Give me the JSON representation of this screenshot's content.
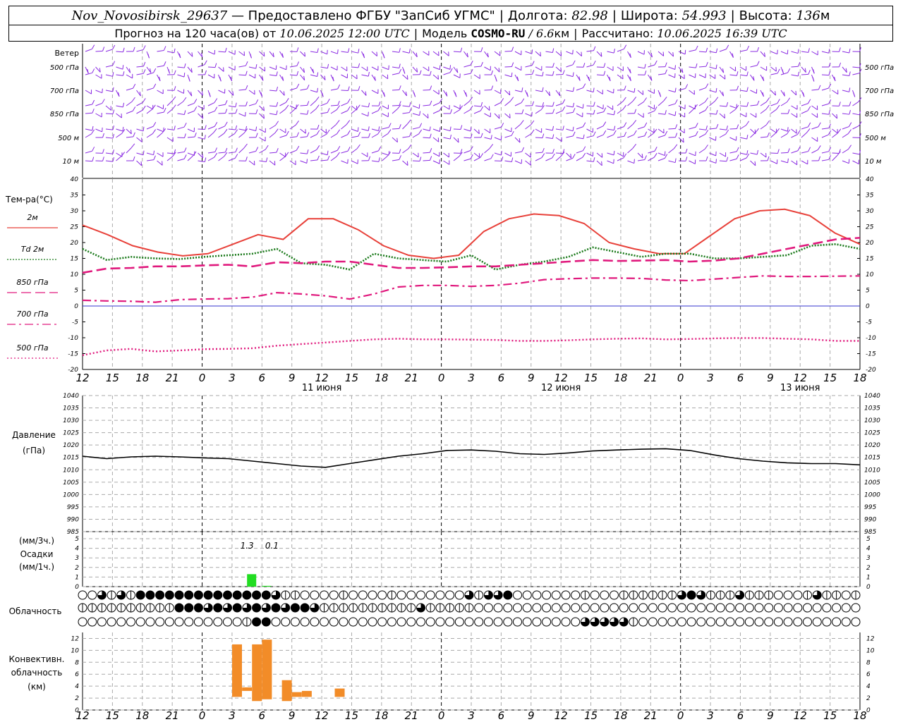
{
  "header": {
    "station": "Nov_Novosibirsk_29637",
    "provider": "— Предоставлено ФГБУ \"ЗапСиб УГМС\"",
    "lon_label": "Долгота:",
    "lon": "82.98",
    "lat_label": "Широта:",
    "lat": "54.993",
    "alt_label": "Высота:",
    "alt": "136",
    "alt_unit": "м",
    "forecast_label": "Прогноз на 120 часа(ов) от",
    "forecast_time": "10.06.2025 12:00 UTC",
    "model_label": "Модель",
    "model": "COSMO-RU",
    "resolution": "/ 6.6",
    "res_unit": "км",
    "computed_label": "Рассчитано:",
    "computed_time": "10.06.2025 16:39 UTC"
  },
  "time_axis": {
    "ticks": [
      "12",
      "15",
      "18",
      "21",
      "0",
      "3",
      "6",
      "9",
      "12",
      "15",
      "18",
      "21",
      "0",
      "3",
      "6",
      "9",
      "12",
      "15",
      "18",
      "21",
      "0",
      "3",
      "6",
      "9",
      "12",
      "15",
      "18"
    ],
    "dates": [
      {
        "label": "11 июня",
        "hour": 24
      },
      {
        "label": "12 июня",
        "hour": 48
      },
      {
        "label": "13 июня",
        "hour": 72
      }
    ],
    "midnight_hours": [
      12,
      36,
      60
    ]
  },
  "wind_panel": {
    "title": "Ветер",
    "levels": [
      "500 гПа",
      "700 гПа",
      "850 гПа",
      "500 м",
      "10 м"
    ]
  },
  "colors": {
    "t2m": "#e8413a",
    "td2m": "#1b7a1b",
    "t850": "#e0197d",
    "t700": "#e0197d",
    "t500": "#e0197d",
    "wind": "#8a2be2",
    "pressure": "#000000",
    "precip": "#22dd22",
    "convective": "#f28c28",
    "zero_line": "#3333cc"
  },
  "chart_data": [
    {
      "type": "line",
      "title": "Тем-ра(°C)",
      "ylim": [
        -20,
        40
      ],
      "y_ticks": [
        -20,
        -15,
        -10,
        -5,
        0,
        5,
        10,
        15,
        20,
        25,
        30,
        35,
        40
      ],
      "x_hours": [
        0,
        3,
        6,
        9,
        12,
        15,
        18,
        21,
        24,
        27,
        30,
        33,
        36,
        39,
        42,
        45,
        48,
        51,
        54,
        57,
        60,
        63,
        66,
        69,
        72,
        75,
        78
      ],
      "series": [
        {
          "name": "2м",
          "style": "solid",
          "values": [
            25.5,
            22.5,
            19,
            17,
            15.8,
            16.5,
            19.5,
            22.5,
            21,
            27.5,
            27.5,
            24,
            19,
            16,
            15,
            16,
            23.5,
            27.5,
            29,
            28.5,
            26,
            20,
            18,
            16.5,
            16.5,
            22,
            27.5,
            30,
            30.5,
            28.5,
            23,
            19.5
          ]
        },
        {
          "name": "Td 2м",
          "style": "dotted",
          "values": [
            18,
            14.5,
            15.5,
            15,
            14.8,
            15.5,
            16,
            16.5,
            18,
            13.5,
            13,
            11.5,
            16.5,
            15,
            14.5,
            14,
            16,
            11.5,
            13,
            14,
            15.5,
            18.5,
            17,
            15.5,
            16.5,
            16.5,
            15,
            15,
            15.5,
            16,
            19,
            19.5,
            18
          ]
        },
        {
          "name": "850 гПа",
          "style": "dashed",
          "values": [
            10.5,
            11.8,
            12,
            12.5,
            12.5,
            12.8,
            13,
            12.5,
            13.8,
            13.5,
            14,
            14,
            13,
            12,
            12,
            12.2,
            12.5,
            12.5,
            13,
            13.5,
            14,
            14.5,
            14.2,
            14.3,
            14.5,
            14,
            14.3,
            15,
            16.5,
            18,
            19.5,
            21,
            21.5
          ]
        },
        {
          "name": "700 гПа",
          "style": "dashdot",
          "values": [
            1.8,
            1.6,
            1.5,
            1.2,
            2,
            2.2,
            2.3,
            2.8,
            4.2,
            3.8,
            3.2,
            2.2,
            3.8,
            6,
            6.5,
            6.5,
            6.2,
            6.5,
            7.2,
            8.3,
            8.6,
            8.8,
            8.8,
            8.7,
            8.2,
            8,
            8.5,
            9,
            9.5,
            9.3,
            9.3,
            9.4,
            9.5
          ]
        },
        {
          "name": "500 гПа",
          "style": "dotted-fine",
          "values": [
            -15.5,
            -14,
            -13.5,
            -14.3,
            -14,
            -13.6,
            -13.5,
            -13.3,
            -12.5,
            -12,
            -11.5,
            -11,
            -10.5,
            -10.3,
            -10.5,
            -10.5,
            -10.6,
            -10.7,
            -11,
            -11,
            -10.8,
            -10.5,
            -10.3,
            -10.2,
            -10.5,
            -10.4,
            -10.2,
            -10.1,
            -10.1,
            -10.3,
            -10.5,
            -11,
            -11
          ]
        }
      ]
    },
    {
      "type": "line",
      "title": "Давление",
      "unit": "(гПа)",
      "ylim": [
        985,
        1040
      ],
      "y_ticks": [
        985,
        990,
        995,
        1000,
        1005,
        1010,
        1015,
        1020,
        1025,
        1030,
        1035,
        1040
      ],
      "x_hours": [
        0,
        3,
        6,
        9,
        12,
        15,
        18,
        21,
        24,
        27,
        30,
        33,
        36,
        39,
        42,
        45,
        48,
        51,
        54,
        57,
        60,
        63,
        66,
        69,
        72,
        75,
        78
      ],
      "series": [
        {
          "name": "Давление",
          "values": [
            1015.5,
            1014.5,
            1015.2,
            1015.5,
            1015.2,
            1014.8,
            1014.5,
            1013.5,
            1012.5,
            1011.5,
            1011,
            1012.5,
            1014,
            1015.5,
            1016.5,
            1017.8,
            1018,
            1017.5,
            1016.5,
            1016.2,
            1016.8,
            1017.6,
            1018,
            1018.3,
            1018.5,
            1017.8,
            1016,
            1014.5,
            1013.5,
            1012.8,
            1012.5,
            1012.5,
            1012
          ]
        }
      ]
    },
    {
      "type": "bar",
      "title": "Осадки",
      "units": [
        "(мм/3ч.)",
        "(мм/1ч.)"
      ],
      "ylim": [
        0,
        5
      ],
      "y_ticks": [
        0,
        1,
        2,
        3,
        4,
        5
      ],
      "labels": [
        {
          "text": "1.3",
          "hour": 16.5
        },
        {
          "text": "0.1",
          "hour": 19
        }
      ],
      "bars": [
        {
          "hour": 17,
          "value": 1.3
        },
        {
          "hour": 18.5,
          "value": 0.08
        }
      ]
    },
    {
      "type": "table",
      "title": "Облачность",
      "rows": [
        {
          "layer": "upper",
          "cells": [
            0,
            0,
            2,
            1,
            2,
            1,
            3,
            3,
            3,
            3,
            3,
            3,
            3,
            3,
            3,
            3,
            3,
            3,
            3,
            3,
            2,
            1,
            1,
            0,
            0,
            0,
            0,
            1,
            0,
            0,
            0,
            0,
            1,
            0,
            0,
            0,
            0,
            0,
            0,
            0,
            2,
            1,
            2,
            2,
            3,
            0,
            0,
            0,
            0,
            0,
            0,
            0,
            1,
            0,
            0,
            0,
            1,
            1,
            1,
            1,
            1,
            1,
            2,
            3,
            2,
            1,
            1,
            1,
            2,
            1,
            1,
            1,
            0,
            0,
            0,
            1,
            2,
            1,
            1,
            0,
            1,
            1,
            1,
            1,
            1,
            1,
            1,
            1,
            2,
            1,
            1,
            1,
            1,
            0,
            0,
            0,
            0,
            0,
            0,
            0
          ]
        },
        {
          "layer": "middle",
          "cells": [
            1,
            1,
            1,
            1,
            1,
            1,
            1,
            1,
            1,
            1,
            3,
            3,
            3,
            2,
            3,
            2,
            3,
            2,
            3,
            2,
            3,
            2,
            3,
            3,
            2,
            1,
            1,
            1,
            1,
            1,
            1,
            1,
            1,
            1,
            1,
            2,
            1,
            1,
            1,
            1,
            1,
            0,
            0,
            0,
            0,
            0,
            0,
            0,
            0,
            0,
            0,
            0,
            0,
            0,
            0,
            0,
            0,
            0,
            0,
            0,
            0,
            0,
            0,
            0,
            0,
            0,
            0,
            0,
            0,
            0,
            0,
            0,
            0,
            0,
            0,
            0,
            0,
            0,
            0,
            0,
            0,
            0,
            0,
            0,
            0,
            0,
            0,
            0,
            0,
            0,
            0,
            0,
            0,
            0,
            0,
            0,
            0,
            0,
            0,
            0
          ]
        },
        {
          "layer": "lower",
          "cells": [
            0,
            0,
            0,
            0,
            0,
            0,
            0,
            0,
            0,
            0,
            0,
            0,
            0,
            0,
            0,
            0,
            0,
            1,
            3,
            3,
            0,
            0,
            0,
            0,
            0,
            0,
            0,
            0,
            0,
            0,
            0,
            0,
            0,
            0,
            0,
            0,
            0,
            0,
            0,
            0,
            0,
            0,
            0,
            0,
            0,
            0,
            0,
            0,
            0,
            0,
            0,
            0,
            2,
            2,
            2,
            2,
            2,
            1,
            0,
            0,
            0,
            0,
            0,
            0,
            0,
            0,
            0,
            0,
            0,
            0,
            0,
            0,
            0,
            0,
            0,
            0,
            0,
            0,
            0,
            0,
            0,
            0,
            0,
            0,
            0,
            0,
            0,
            0,
            0,
            0,
            0,
            0,
            0,
            0,
            0,
            0,
            0,
            0,
            0,
            0
          ]
        }
      ]
    },
    {
      "type": "bar",
      "title": "Конвективн. облачность",
      "unit": "(км)",
      "ylim": [
        0,
        13
      ],
      "y_ticks": [
        0,
        2,
        4,
        6,
        8,
        10,
        12
      ],
      "bars": [
        {
          "hour": 15.5,
          "base": 2.2,
          "top": 11
        },
        {
          "hour": 16.5,
          "base": 3.2,
          "top": 3.8
        },
        {
          "hour": 17.5,
          "base": 1.5,
          "top": 11
        },
        {
          "hour": 18.5,
          "base": 1.8,
          "top": 11.8
        },
        {
          "hour": 20.5,
          "base": 1.5,
          "top": 5
        },
        {
          "hour": 21.5,
          "base": 2.2,
          "top": 3
        },
        {
          "hour": 22.5,
          "base": 2.2,
          "top": 3.2
        },
        {
          "hour": 25.8,
          "base": 2.2,
          "top": 3.6
        }
      ]
    }
  ]
}
